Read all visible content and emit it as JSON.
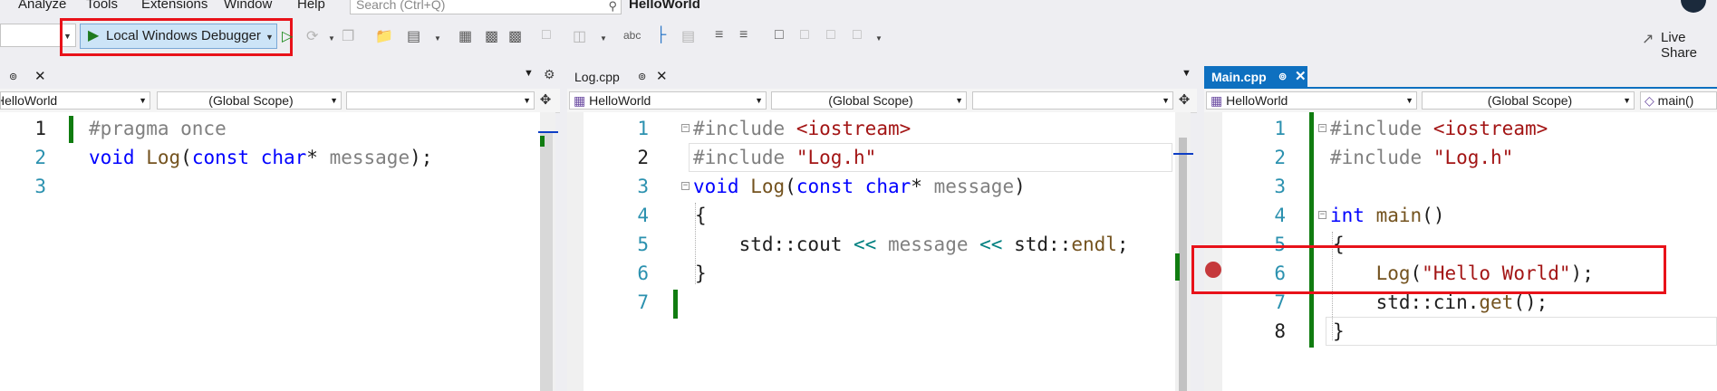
{
  "menu": {
    "items": [
      {
        "label": "Analyze"
      },
      {
        "label": "Tools"
      },
      {
        "label": "Extensions"
      },
      {
        "label": "Window"
      },
      {
        "label": "Help"
      }
    ],
    "search_placeholder": "Search (Ctrl+Q)",
    "window_title": "HelloWorld"
  },
  "toolbar": {
    "debugger_label": "Local Windows Debugger",
    "live_share_label": "Live Share"
  },
  "panes": {
    "log_h": {
      "tab": {
        "label": ""
      },
      "nav": {
        "project": "HelloWorld",
        "scope": "(Global Scope)",
        "member": ""
      },
      "line_numbers": [
        "1",
        "2",
        "3"
      ],
      "code": {
        "l1_pp": "#pragma once",
        "l2_kw1": "void",
        "l2_fn": "Log",
        "l2_p1": "(",
        "l2_kw2": "const",
        "l2_kw3": "char",
        "l2_star": "*",
        "l2_prm": "message",
        "l2_end": ");"
      }
    },
    "log_cpp": {
      "tab": {
        "label": "Log.cpp"
      },
      "nav": {
        "project": "HelloWorld",
        "scope": "(Global Scope)",
        "member": ""
      },
      "line_numbers": [
        "1",
        "2",
        "3",
        "4",
        "5",
        "6",
        "7"
      ],
      "code": {
        "l1_pp": "#include",
        "l1_str": "<iostream>",
        "l2_pp": "#include",
        "l2_str": "\"Log.h\"",
        "l3_kw1": "void",
        "l3_fn": "Log",
        "l3_p1": "(",
        "l3_kw2": "const",
        "l3_kw3": "char",
        "l3_star": "*",
        "l3_prm": "message",
        "l3_end": ")",
        "l4": "{",
        "l5_a": "std::cout",
        "l5_op1": "<<",
        "l5_prm": "message",
        "l5_op2": "<<",
        "l5_b": "std::",
        "l5_fn": "endl",
        "l5_end": ";",
        "l6": "}"
      }
    },
    "main_cpp": {
      "tab": {
        "label": "Main.cpp"
      },
      "nav": {
        "project": "HelloWorld",
        "scope": "(Global Scope)",
        "member": "main()"
      },
      "line_numbers": [
        "1",
        "2",
        "3",
        "4",
        "5",
        "6",
        "7",
        "8"
      ],
      "code": {
        "l1_pp": "#include",
        "l1_str": "<iostream>",
        "l2_pp": "#include",
        "l2_str": "\"Log.h\"",
        "l4_kw": "int",
        "l4_fn": "main",
        "l4_end": "()",
        "l5": "{",
        "l6_fn": "Log",
        "l6_p1": "(",
        "l6_str": "\"Hello World\"",
        "l6_end": ");",
        "l7_a": "std::cin.",
        "l7_fn": "get",
        "l7_end": "();",
        "l8": "}"
      }
    }
  },
  "colors": {
    "highlight_box": "#e8121a",
    "active_tab": "#0e70c0",
    "change_bar": "#107c10",
    "breakpoint": "#c5393c"
  },
  "icons": [
    "start-without-debugging-icon",
    "hot-reload-icon",
    "browse-icon",
    "bookmark-icon",
    "comment-icon",
    "spell-check-icon",
    "live-share-icon",
    "split-editor-icon",
    "pin-icon",
    "close-icon",
    "search-icon"
  ]
}
